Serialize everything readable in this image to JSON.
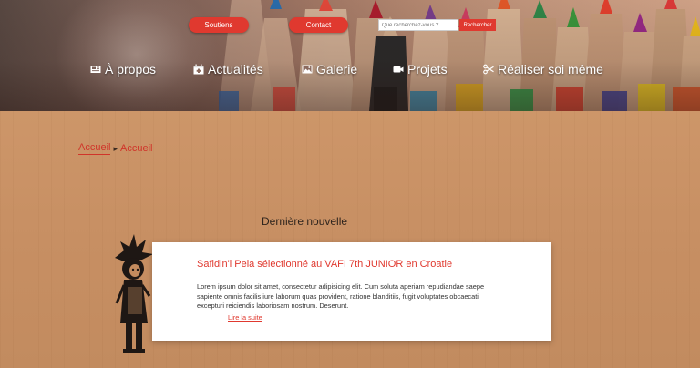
{
  "header": {
    "soutiens_label": "Soutiens",
    "contact_label": "Contact",
    "search": {
      "placeholder": "Que recherchez-vous ?",
      "button_label": "Rechercher"
    },
    "nav": [
      {
        "label": "À propos",
        "icon": "newspaper-icon"
      },
      {
        "label": "Actualités",
        "icon": "calendar-icon"
      },
      {
        "label": "Galerie",
        "icon": "image-icon"
      },
      {
        "label": "Projets",
        "icon": "video-camera-icon"
      },
      {
        "label": "Réaliser soi même",
        "icon": "scissors-icon"
      }
    ]
  },
  "breadcrumb": {
    "items": [
      "Accueil",
      "Accueil"
    ],
    "separator": "▸"
  },
  "news": {
    "section_title": "Dernière nouvelle",
    "title": "Safidin'i Pela sélectionné au VAFI 7th JUNIOR en Croatie",
    "excerpt": "Lorem ipsum dolor sit amet, consectetur adipisicing elit. Cum soluta aperiam repudiandae saepe sapiente omnis facilis iure laborum quas provident, ratione blanditiis, fugit voluptates obcaecati excepturi reiciendis laboriosam nostrum. Deserunt.",
    "read_more": "Lire la suite"
  },
  "colors": {
    "accent": "#e0392f",
    "cardboard": "#c89063",
    "text_dark": "#2f241d"
  }
}
